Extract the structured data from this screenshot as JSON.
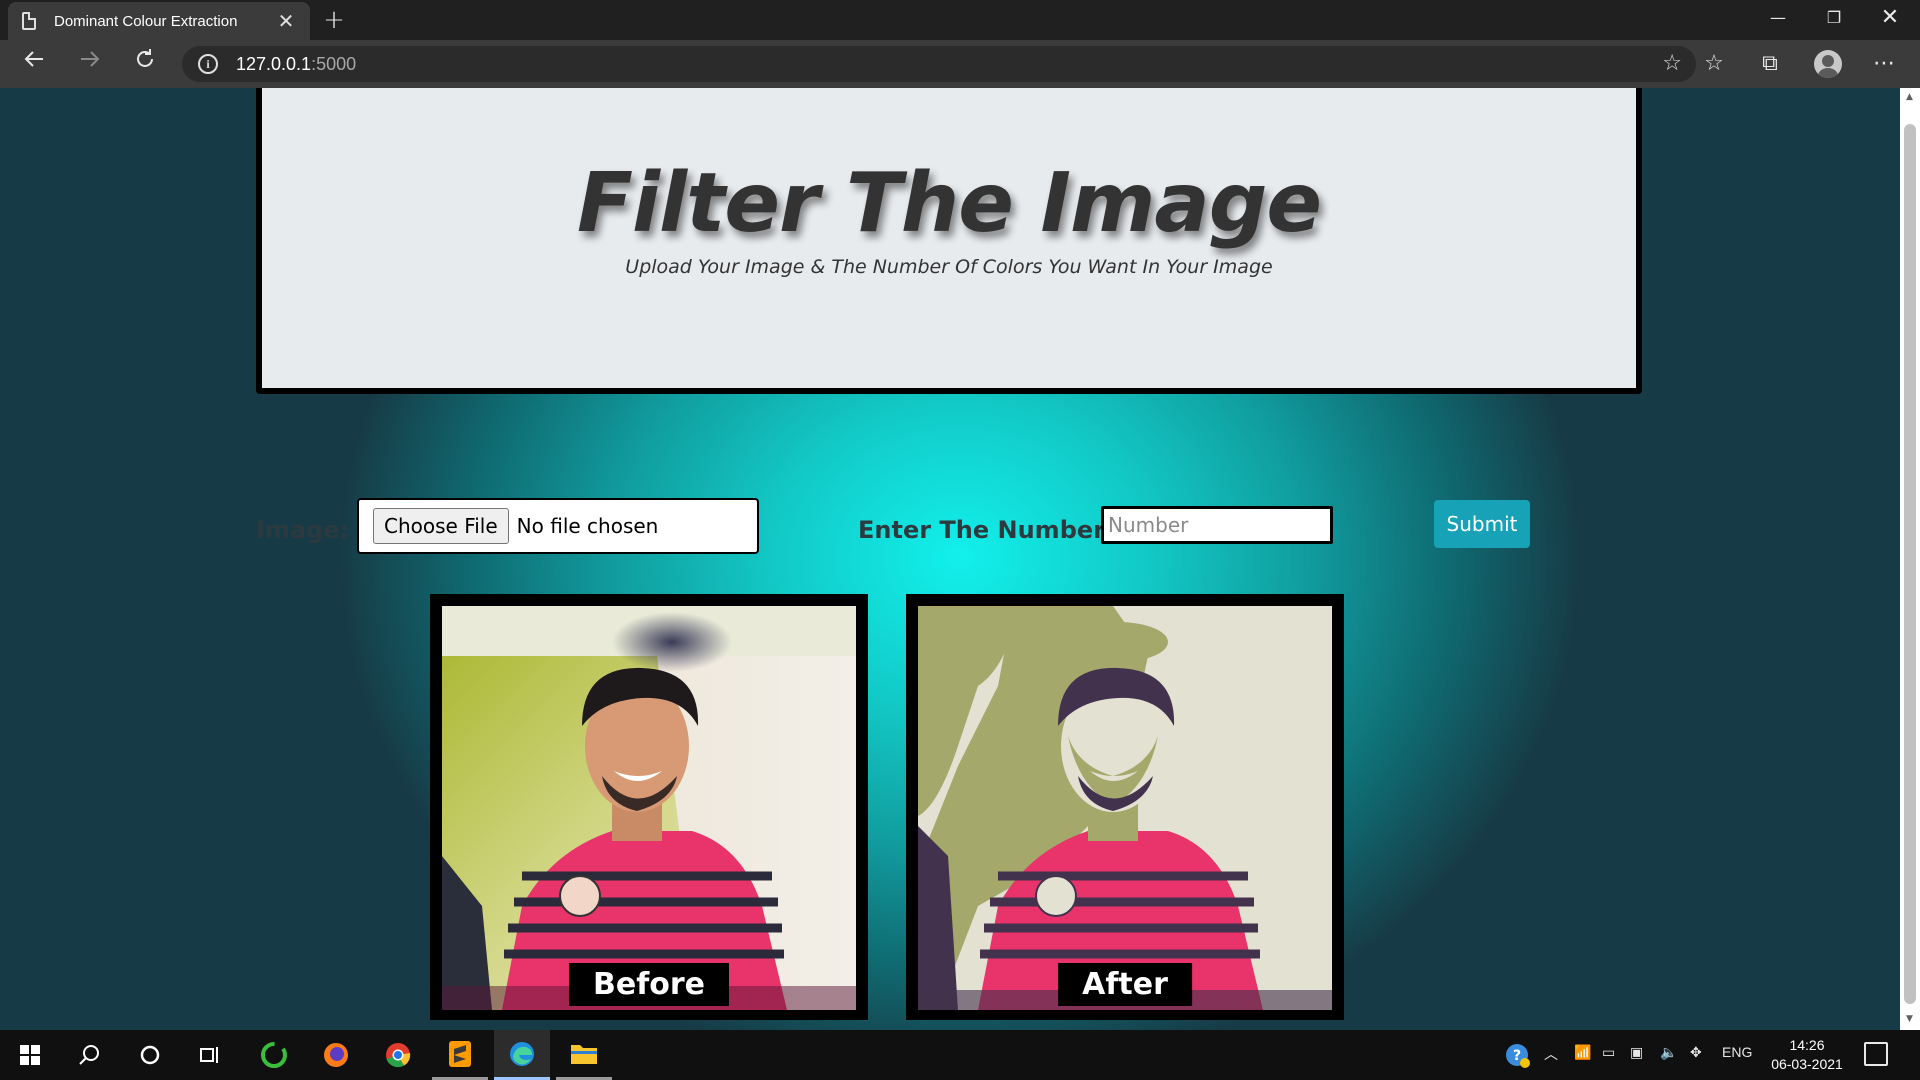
{
  "browser": {
    "tab_title": "Dominant Colour Extraction",
    "tab_close": "✕",
    "new_tab": "+",
    "url_host": "127.0.0.1",
    "url_port": ":5000",
    "window_controls": {
      "minimize": "—",
      "restore": "❐",
      "close": "✕"
    },
    "icons": [
      "page-icon",
      "back-icon",
      "forward-icon",
      "refresh-icon",
      "info-icon",
      "add-favorite-icon",
      "favorites-icon",
      "collections-icon",
      "profile-avatar",
      "more-icon"
    ]
  },
  "page": {
    "title": "Filter The Image",
    "subtitle": "Upload Your Image & The Number Of Colors You Want In Your Image",
    "form": {
      "image_label": "Image:",
      "choose_file_label": "Choose File",
      "file_status": "No file chosen",
      "number_label": "Enter The Number:",
      "number_placeholder": "Number",
      "submit_label": "Submit"
    },
    "images": {
      "before_caption": "Before",
      "after_caption": "After"
    }
  },
  "taskbar": {
    "apps": [
      "windows-start-icon",
      "search-icon",
      "cortana-icon",
      "task-view-icon",
      "circular-app-icon",
      "firefox-icon",
      "chrome-icon",
      "sublime-text-icon",
      "edge-icon",
      "file-explorer-icon"
    ],
    "language": "ENG",
    "time": "14:26",
    "date": "06-03-2021"
  },
  "colors": {
    "accent_submit": "#17a2b8",
    "hero_bg": "#e8ebee",
    "page_glow": "#12f0ec",
    "shirt_pink": "#e8336b"
  }
}
